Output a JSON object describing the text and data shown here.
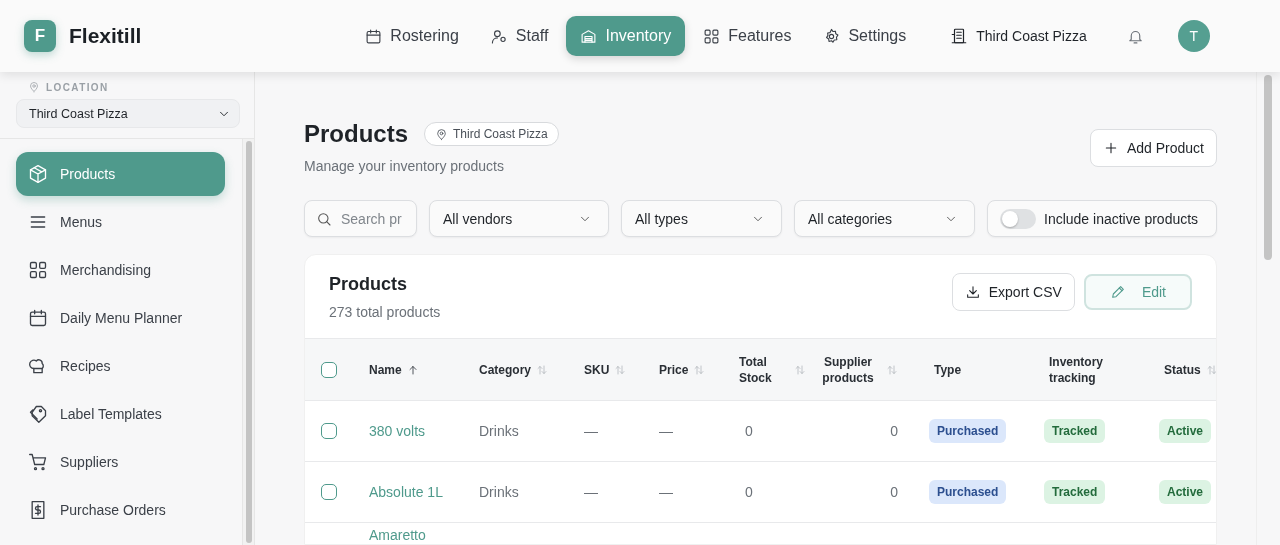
{
  "app": {
    "logo_letter": "F",
    "name": "Flexitill"
  },
  "nav": [
    {
      "label": "Rostering",
      "selected": false
    },
    {
      "label": "Staff",
      "selected": false
    },
    {
      "label": "Inventory",
      "selected": true
    },
    {
      "label": "Features",
      "selected": false
    },
    {
      "label": "Settings",
      "selected": false
    }
  ],
  "business": {
    "name": "Third Coast Pizza"
  },
  "avatar": {
    "initial": "T"
  },
  "sidebar": {
    "location_label": "LOCATION",
    "location_value": "Third Coast Pizza",
    "items": [
      {
        "label": "Products",
        "selected": true
      },
      {
        "label": "Menus",
        "selected": false
      },
      {
        "label": "Merchandising",
        "selected": false
      },
      {
        "label": "Daily Menu Planner",
        "selected": false
      },
      {
        "label": "Recipes",
        "selected": false
      },
      {
        "label": "Label Templates",
        "selected": false
      },
      {
        "label": "Suppliers",
        "selected": false
      },
      {
        "label": "Purchase Orders",
        "selected": false
      }
    ]
  },
  "page": {
    "title": "Products",
    "location_chip": "Third Coast Pizza",
    "subtitle": "Manage your inventory products",
    "add_button": "Add Product"
  },
  "filters": {
    "search_placeholder": "Search pr",
    "vendor": "All vendors",
    "type": "All types",
    "category": "All categories",
    "inactive_toggle": {
      "label": "Include inactive products",
      "on": false
    }
  },
  "table": {
    "title": "Products",
    "count": "273 total products",
    "export_button": "Export CSV",
    "edit_button": "Edit",
    "select_all": {
      "checked": false
    },
    "columns": [
      {
        "kind": "text",
        "label": "Name",
        "sorted": true
      },
      {
        "kind": "text",
        "label": "Category",
        "sorted": false
      },
      {
        "kind": "text",
        "label": "SKU",
        "sorted": false
      },
      {
        "kind": "text",
        "label": "Price",
        "sorted": false
      },
      {
        "kind": "text",
        "label": "Total Stock",
        "sorted": false
      },
      {
        "kind": "num",
        "label": "Supplier products",
        "sorted": false
      },
      {
        "kind": "badge",
        "label": "Type"
      },
      {
        "kind": "badge",
        "label": "Inventory tracking"
      },
      {
        "kind": "badge",
        "label": "Status",
        "sorted": false
      }
    ],
    "rows": [
      {
        "checked": false,
        "cells": [
          "380 volts",
          "Drinks",
          "—",
          "—",
          "0",
          "0",
          {
            "text": "Purchased",
            "color": "#dbe7fb"
          },
          {
            "text": "Tracked",
            "color": "#dcf3e3"
          },
          {
            "text": "Active",
            "color": "#dcf3e3"
          }
        ]
      },
      {
        "checked": false,
        "cells": [
          "Absolute 1L",
          "Drinks",
          "—",
          "—",
          "0",
          "0",
          {
            "text": "Purchased",
            "color": "#dbe7fb"
          },
          {
            "text": "Tracked",
            "color": "#dcf3e3"
          },
          {
            "text": "Active",
            "color": "#dcf3e3"
          }
        ]
      },
      {
        "cells": [
          "Amaretto"
        ]
      }
    ]
  }
}
